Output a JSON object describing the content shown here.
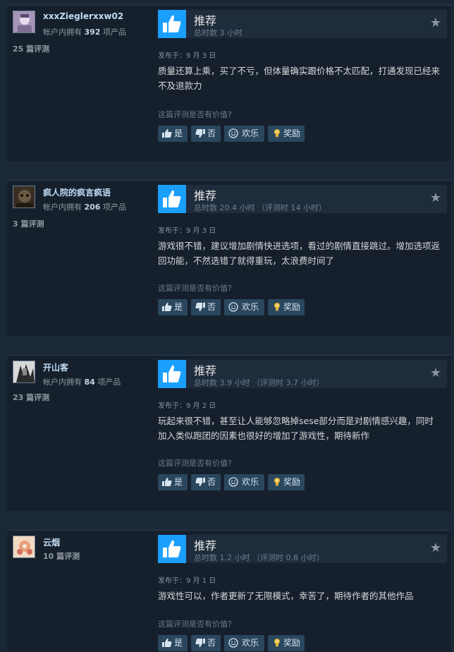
{
  "colors": {
    "thumb_bg": "#1a9fff",
    "button_bg": "#2a475e",
    "page_bg": "#1b2838"
  },
  "ui": {
    "recommended": "推荐",
    "hours_prefix": "总时数",
    "posted_prefix": "发布于：",
    "helpful_question": "这篇评测是否有价值?",
    "btn_yes": "是",
    "btn_no": "否",
    "btn_funny": "欢乐",
    "btn_award": "奖励"
  },
  "reviews": [
    {
      "username": "xxxZieglerxxw02",
      "owned_prefix": "帐户内拥有",
      "owned_count": "392",
      "owned_suffix": "项产品",
      "review_count": "25 篇评测",
      "hours": "总时数 3 小时",
      "posted": "发布于：9 月 3 日",
      "content": "质量还算上乘，买了不亏，但体量确实跟价格不太匹配，打通发现已经来不及退款力"
    },
    {
      "username": "疯人院的疯言疯语",
      "owned_prefix": "帐户内拥有",
      "owned_count": "206",
      "owned_suffix": "项产品",
      "review_count": "3 篇评测",
      "hours": "总时数 20.4 小时 （评测时 14 小时）",
      "posted": "发布于：9 月 3 日",
      "content": "游戏很不错，建议增加剧情快进选项，看过的剧情直接跳过。增加选项返回功能，不然选错了就得重玩，太浪费时间了"
    },
    {
      "username": "开山客",
      "owned_prefix": "帐户内拥有",
      "owned_count": "84",
      "owned_suffix": "项产品",
      "review_count": "23 篇评测",
      "hours": "总时数 3.9 小时 （评测时 3.7 小时）",
      "posted": "发布于：9 月 2 日",
      "content": "玩起来很不错，甚至让人能够忽略掉sese部分而是对剧情感兴趣，同时加入类似跑团的因素也很好的增加了游戏性，期待新作"
    },
    {
      "username": "云烟",
      "review_count": "10 篇评测",
      "hours": "总时数 1.2 小时 （评测时 0.8 小时）",
      "posted": "发布于：9 月 1 日",
      "content": "游戏性可以，作者更新了无限模式，幸苦了，期待作者的其他作品"
    }
  ]
}
